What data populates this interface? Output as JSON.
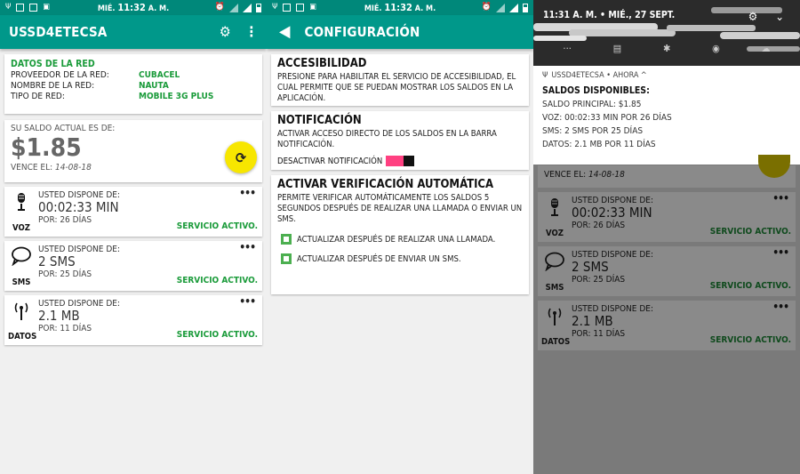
{
  "status_bar": {
    "time_prefix": "MIÉ.",
    "time": "11:32",
    "time_suffix": "A. M."
  },
  "main": {
    "app_title": "USSD4ETECSA",
    "network": {
      "title": "DATOS DE LA RED",
      "rows": [
        {
          "key": "PROVEEDOR DE LA RED:",
          "value": "CUBACEL"
        },
        {
          "key": "NOMBRE DE LA RED:",
          "value": "NAUTA"
        },
        {
          "key": "TIPO DE RED:",
          "value": "MOBILE 3G PLUS"
        }
      ]
    },
    "balance": {
      "label": "SU SALDO ACTUAL ES DE:",
      "amount": "$1.85",
      "expires_label": "VENCE EL:",
      "expires_value": "14-08-18"
    },
    "services": [
      {
        "icon": "microphone-icon",
        "label": "VOZ",
        "head": "USTED DISPONE DE:",
        "value": "00:02:33 MIN",
        "days": "POR:  26 DÍAS",
        "status": "SERVICIO ACTIVO."
      },
      {
        "icon": "chat-bubble-icon",
        "label": "SMS",
        "head": "USTED DISPONE DE:",
        "value": "2 SMS",
        "days": "POR:  25 DÍAS",
        "status": "SERVICIO ACTIVO."
      },
      {
        "icon": "antenna-icon",
        "label": "DATOS",
        "head": "USTED DISPONE DE:",
        "value": "2.1 MB",
        "days": "POR:  11 DÍAS",
        "status": "SERVICIO ACTIVO."
      }
    ],
    "more_glyph": "•••"
  },
  "config": {
    "title": "CONFIGURACIÓN",
    "accessibility": {
      "title": "ACCESIBILIDAD",
      "desc": "PRESIONE PARA HABILITAR EL SERVICIO DE ACCESIBILIDAD, EL CUAL PERMITE QUE SE PUEDAN MOSTRAR LOS SALDOS EN LA APLICACIÓN."
    },
    "notification": {
      "title": "NOTIFICACIÓN",
      "desc": "ACTIVAR ACCESO DIRECTO DE LOS SALDOS EN LA BARRA NOTIFICACIÓN.",
      "toggle_label": "DESACTIVAR NOTIFICACIÓN"
    },
    "auto_verify": {
      "title": "ACTIVAR VERIFICACIÓN AUTOMÁTICA",
      "desc": "PERMITE VERIFICAR AUTOMÁTICAMENTE LOS SALDOS 5 SEGUNDOS DESPUÉS DE REALIZAR UNA LLAMADA O ENVIAR UN SMS.",
      "option1": "ACTUALIZAR DESPUÉS DE REALIZAR UNA LLAMADA.",
      "option2": "ACTUALIZAR DESPUÉS DE ENVIAR UN SMS."
    }
  },
  "shade": {
    "time_line": "11:31 A. M. • MIÉ., 27 SEPT.",
    "notif_app": "USSD4ETECSA • AHORA ^",
    "notif_title": "SALDOS DISPONIBLES:",
    "lines": [
      "SALDO PRINCIPAL: $1.85",
      "VOZ: 00:02:33 MIN POR 26 DÍAS",
      "SMS: 2 SMS POR 25 DÍAS",
      "DATOS: 2.1 MB POR 11 DÍAS"
    ]
  },
  "colors": {
    "appbar": "#00988a",
    "status": "#00887a",
    "accent_green": "#1a9b3a",
    "fab": "#f7e600",
    "toggle": "#ff4081"
  }
}
